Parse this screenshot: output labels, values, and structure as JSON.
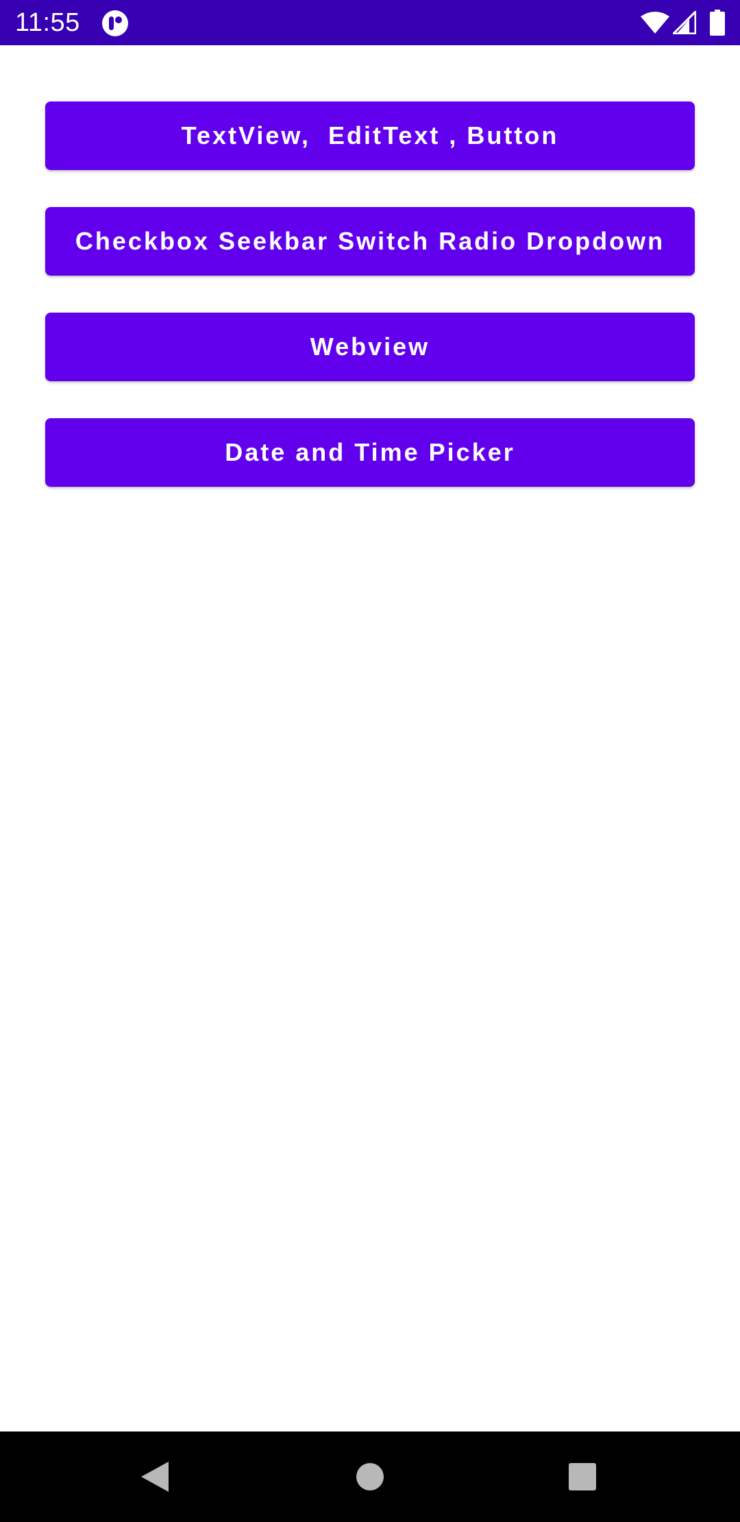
{
  "status_bar": {
    "time": "11:55",
    "icons": [
      "app-notification-icon",
      "wifi-icon",
      "signal-icon",
      "battery-icon"
    ],
    "background_color": "#3700B3"
  },
  "main": {
    "buttons": [
      {
        "label": "TextView,  EditText , Button"
      },
      {
        "label": "Checkbox Seekbar Switch Radio Dropdown"
      },
      {
        "label": "Webview"
      },
      {
        "label": "Date and Time Picker"
      }
    ],
    "button_color": "#6200EE",
    "button_text_color": "#FFFFFF"
  },
  "nav_bar": {
    "icons": [
      "back-icon",
      "home-icon",
      "recents-icon"
    ],
    "background_color": "#000000"
  }
}
